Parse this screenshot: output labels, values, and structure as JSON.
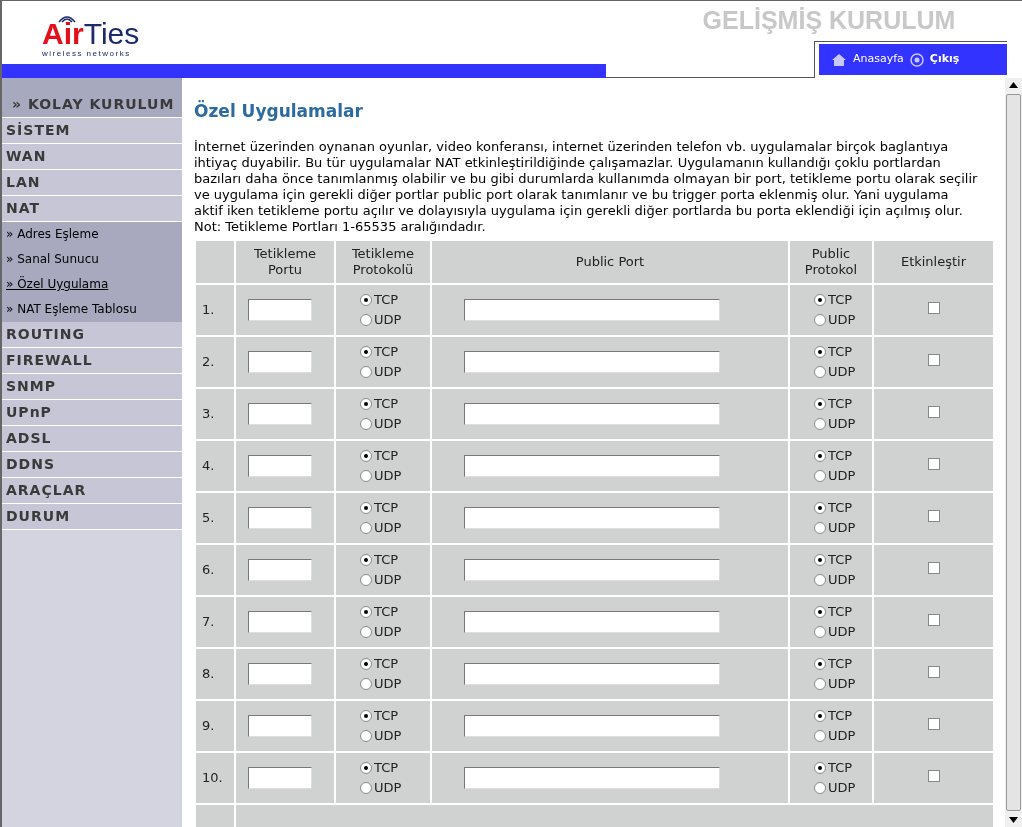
{
  "header": {
    "logo": {
      "brand_a": "Air",
      "brand_b": "Ties",
      "tagline": "wireless networks"
    },
    "title": "GELİŞMİŞ KURULUM",
    "nav": [
      "Anasayfa",
      "Çıkış"
    ]
  },
  "sidebar": {
    "items": [
      {
        "label": "» KOLAY KURULUM",
        "kind": "top",
        "selected": false
      },
      {
        "label": "SİSTEM",
        "kind": "main",
        "selected": false
      },
      {
        "label": "WAN",
        "kind": "main",
        "selected": false
      },
      {
        "label": "LAN",
        "kind": "main",
        "selected": false
      },
      {
        "label": "NAT",
        "kind": "main",
        "selected": false
      },
      {
        "label": "» Adres Eşleme",
        "kind": "sub",
        "selected": false
      },
      {
        "label": "» Sanal Sunucu",
        "kind": "sub",
        "selected": false
      },
      {
        "label": "» Özel Uygulama",
        "kind": "sub",
        "selected": true
      },
      {
        "label": "» NAT Eşleme Tablosu",
        "kind": "sub",
        "selected": false
      },
      {
        "label": "ROUTING",
        "kind": "main",
        "selected": false
      },
      {
        "label": "FIREWALL",
        "kind": "main",
        "selected": false
      },
      {
        "label": "SNMP",
        "kind": "main",
        "selected": false
      },
      {
        "label": "UPnP",
        "kind": "main",
        "selected": false
      },
      {
        "label": "ADSL",
        "kind": "main",
        "selected": false
      },
      {
        "label": "DDNS",
        "kind": "main",
        "selected": false
      },
      {
        "label": "ARAÇLAR",
        "kind": "main",
        "selected": false
      },
      {
        "label": "DURUM",
        "kind": "main",
        "selected": false
      }
    ]
  },
  "content": {
    "title": "Özel Uygulamalar",
    "description": "İnternet üzerinden oynanan oyunlar, video konferansı, internet üzerinden telefon vb. uygulamalar birçok baglantıya ihtiyaç duyabilir. Bu tür uygulamalar NAT etkinleştirildiğinde çalışamazlar. Uygulamanın kullandığı çoklu portlardan bazıları daha önce tanımlanmış olabilir ve bu gibi durumlarda kullanımda olmayan bir port, tetikleme portu olarak seçilir ve uygulama için gerekli diğer portlar public port olarak tanımlanır ve bu trigger porta eklenmiş olur. Yani uygulama aktif iken tetikleme portu açılır ve dolayısıyla uygulama için gerekli diğer portlarda bu porta eklendiği için açılmış olur.",
    "note": "Not: Tetikleme Portları 1-65535 aralığındadır.",
    "table": {
      "columns": [
        "Tetikleme Portu",
        "Tetikleme Protokolü",
        "Public Port",
        "Public Protokol",
        "Etkinleştir"
      ],
      "rows": [
        {
          "number": "1.",
          "trigger_protocol": [
            {
              "label": "TCP",
              "selected": true
            },
            {
              "label": "UDP",
              "selected": false
            }
          ],
          "public_protocol": [
            {
              "label": "TCP",
              "selected": true
            },
            {
              "label": "UDP",
              "selected": false
            }
          ],
          "enabled": false
        },
        {
          "number": "2.",
          "trigger_protocol": [
            {
              "label": "TCP",
              "selected": true
            },
            {
              "label": "UDP",
              "selected": false
            }
          ],
          "public_protocol": [
            {
              "label": "TCP",
              "selected": true
            },
            {
              "label": "UDP",
              "selected": false
            }
          ],
          "enabled": false
        },
        {
          "number": "3.",
          "trigger_protocol": [
            {
              "label": "TCP",
              "selected": true
            },
            {
              "label": "UDP",
              "selected": false
            }
          ],
          "public_protocol": [
            {
              "label": "TCP",
              "selected": true
            },
            {
              "label": "UDP",
              "selected": false
            }
          ],
          "enabled": false
        },
        {
          "number": "4.",
          "trigger_protocol": [
            {
              "label": "TCP",
              "selected": true
            },
            {
              "label": "UDP",
              "selected": false
            }
          ],
          "public_protocol": [
            {
              "label": "TCP",
              "selected": true
            },
            {
              "label": "UDP",
              "selected": false
            }
          ],
          "enabled": false
        },
        {
          "number": "5.",
          "trigger_protocol": [
            {
              "label": "TCP",
              "selected": true
            },
            {
              "label": "UDP",
              "selected": false
            }
          ],
          "public_protocol": [
            {
              "label": "TCP",
              "selected": true
            },
            {
              "label": "UDP",
              "selected": false
            }
          ],
          "enabled": false
        },
        {
          "number": "6.",
          "trigger_protocol": [
            {
              "label": "TCP",
              "selected": true
            },
            {
              "label": "UDP",
              "selected": false
            }
          ],
          "public_protocol": [
            {
              "label": "TCP",
              "selected": true
            },
            {
              "label": "UDP",
              "selected": false
            }
          ],
          "enabled": false
        },
        {
          "number": "7.",
          "trigger_protocol": [
            {
              "label": "TCP",
              "selected": true
            },
            {
              "label": "UDP",
              "selected": false
            }
          ],
          "public_protocol": [
            {
              "label": "TCP",
              "selected": true
            },
            {
              "label": "UDP",
              "selected": false
            }
          ],
          "enabled": false
        },
        {
          "number": "8.",
          "trigger_protocol": [
            {
              "label": "TCP",
              "selected": true
            },
            {
              "label": "UDP",
              "selected": false
            }
          ],
          "public_protocol": [
            {
              "label": "TCP",
              "selected": true
            },
            {
              "label": "UDP",
              "selected": false
            }
          ],
          "enabled": false
        },
        {
          "number": "9.",
          "trigger_protocol": [
            {
              "label": "TCP",
              "selected": true
            },
            {
              "label": "UDP",
              "selected": false
            }
          ],
          "public_protocol": [
            {
              "label": "TCP",
              "selected": true
            },
            {
              "label": "UDP",
              "selected": false
            }
          ],
          "enabled": false
        },
        {
          "number": "10.",
          "trigger_protocol": [
            {
              "label": "TCP",
              "selected": true
            },
            {
              "label": "UDP",
              "selected": false
            }
          ],
          "public_protocol": [
            {
              "label": "TCP",
              "selected": true
            },
            {
              "label": "UDP",
              "selected": false
            }
          ],
          "enabled": false
        }
      ]
    }
  }
}
